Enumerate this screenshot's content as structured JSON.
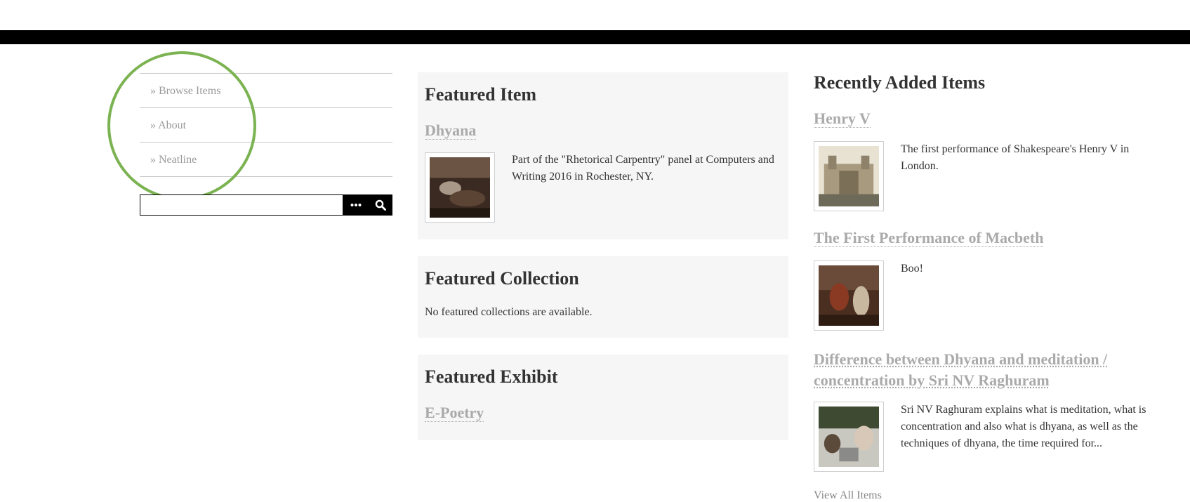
{
  "nav": {
    "items": [
      {
        "label": "» Browse Items"
      },
      {
        "label": "» About"
      },
      {
        "label": "» Neatline"
      }
    ]
  },
  "search": {
    "value": "",
    "advanced_icon": "ellipsis-icon",
    "submit_icon": "search-icon"
  },
  "featured_item": {
    "heading": "Featured Item",
    "title": "Dhyana",
    "description": "Part of the \"Rhetorical Carpentry\" panel at Computers and Writing 2016 in Rochester, NY."
  },
  "featured_collection": {
    "heading": "Featured Collection",
    "text": "No featured collections are available."
  },
  "featured_exhibit": {
    "heading": "Featured Exhibit",
    "title": "E-Poetry"
  },
  "recent": {
    "heading": "Recently Added Items",
    "items": [
      {
        "title": "Henry V",
        "description": "The first performance of Shakespeare's Henry V in London."
      },
      {
        "title": "The First Performance of Macbeth",
        "description": "Boo!"
      },
      {
        "title": "Difference between Dhyana and meditation / concentration by Sri NV Raghuram",
        "description": "Sri NV Raghuram explains what is meditation, what is concentration and also what is dhyana, as well as the techniques of dhyana, the time required for..."
      }
    ],
    "view_all": "View All Items"
  },
  "colors": {
    "accent_circle": "#7cb352",
    "top_bar": "#000000",
    "panel_bg": "#f6f6f6",
    "link_gray": "#aaaaaa"
  }
}
